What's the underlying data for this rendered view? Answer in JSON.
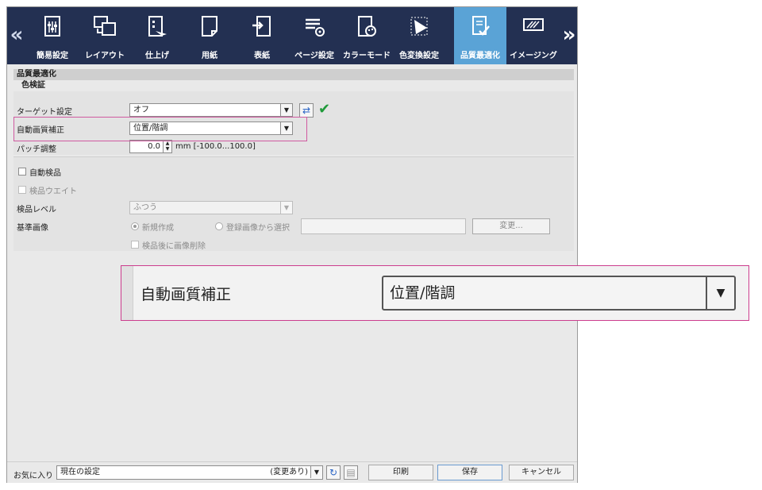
{
  "toolbar": {
    "items": [
      {
        "label": "簡易設定",
        "icon": "simple-settings-icon"
      },
      {
        "label": "レイアウト",
        "icon": "layout-icon"
      },
      {
        "label": "仕上げ",
        "icon": "finishing-icon"
      },
      {
        "label": "用紙",
        "icon": "paper-icon"
      },
      {
        "label": "表紙",
        "icon": "cover-icon"
      },
      {
        "label": "ページ設定",
        "icon": "page-settings-icon"
      },
      {
        "label": "カラーモード",
        "icon": "color-mode-icon"
      },
      {
        "label": "色変換設定",
        "icon": "color-conversion-icon"
      },
      {
        "label": "品質最適化",
        "icon": "quality-optimization-icon",
        "active": true
      },
      {
        "label": "イメージング",
        "icon": "imaging-icon"
      }
    ]
  },
  "section": {
    "title": "品質最適化",
    "subtitle": "色検証"
  },
  "target": {
    "label": "ターゲット設定",
    "value": "オフ"
  },
  "auto_correction": {
    "label": "自動画質補正",
    "value": "位置/階調"
  },
  "patch": {
    "label": "パッチ調整",
    "value": "0.0",
    "unit_range": "mm [-100.0...100.0]"
  },
  "inspection": {
    "auto_inspect": "自動検品",
    "inspect_wait": "検品ウエイト",
    "level_label": "検品レベル",
    "level_value": "ふつう",
    "reference_label": "基準画像",
    "radio_new": "新規作成",
    "radio_registered": "登録画像から選択",
    "change_button": "変更...",
    "delete_after": "検品後に画像削除"
  },
  "footer": {
    "favorites_label": "お気に入り",
    "favorites_value": "現在の設定",
    "changed": "(変更あり)",
    "print": "印刷",
    "save": "保存",
    "cancel": "キャンセル"
  },
  "zoom": {
    "label": "自動画質補正",
    "value": "位置/階調"
  },
  "colors": {
    "toolbar_bg": "#233052",
    "active_tab": "#5aa3d6",
    "highlight": "#cc3d8e",
    "check": "#1f9a3a"
  }
}
